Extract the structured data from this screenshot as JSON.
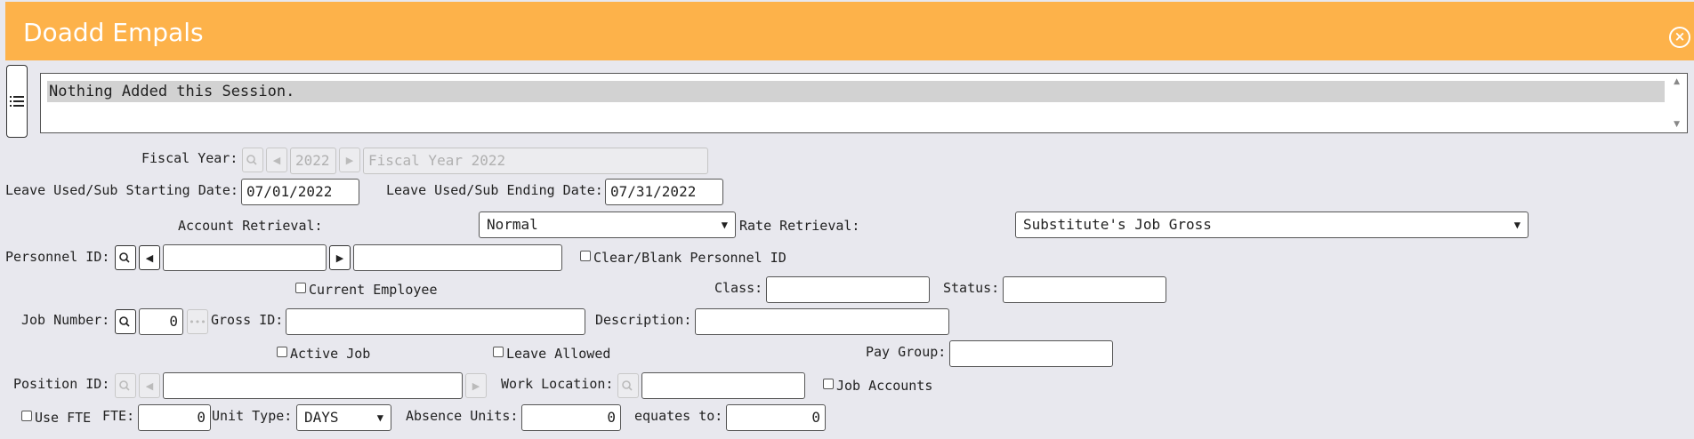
{
  "window": {
    "title": "Doadd Empals"
  },
  "messages": {
    "text": "Nothing Added this Session."
  },
  "fiscal_year": {
    "label": "Fiscal Year:",
    "value": "2022",
    "description": "Fiscal Year 2022"
  },
  "leave": {
    "start_label": "Leave Used/Sub Starting Date:",
    "start_value": "07/01/2022",
    "end_label": "Leave Used/Sub Ending Date:",
    "end_value": "07/31/2022"
  },
  "retrieval": {
    "account_label": "Account Retrieval:",
    "account_value": "Normal",
    "rate_label": "Rate Retrieval:",
    "rate_value": "Substitute's Job Gross"
  },
  "personnel": {
    "label": "Personnel ID:",
    "id_value": "",
    "name_value": "",
    "clear_label": "Clear/Blank Personnel ID",
    "current_employee_label": "Current Employee",
    "class_label": "Class:",
    "class_value": "",
    "status_label": "Status:",
    "status_value": ""
  },
  "job": {
    "number_label": "Job Number:",
    "number_value": "0",
    "gross_label": "Gross ID:",
    "gross_value": "",
    "description_label": "Description:",
    "description_value": "",
    "active_label": "Active Job",
    "leave_allowed_label": "Leave Allowed",
    "pay_group_label": "Pay Group:",
    "pay_group_value": ""
  },
  "position": {
    "label": "Position ID:",
    "value": "",
    "work_location_label": "Work Location:",
    "work_location_value": "",
    "job_accounts_label": "Job Accounts"
  },
  "units": {
    "use_fte_label": "Use FTE",
    "fte_label": "FTE:",
    "fte_value": "0",
    "unit_type_label": "Unit Type:",
    "unit_type_value": "DAYS",
    "absence_label": "Absence Units:",
    "absence_value": "0",
    "equates_label": "equates to:",
    "equates_value": "0"
  }
}
